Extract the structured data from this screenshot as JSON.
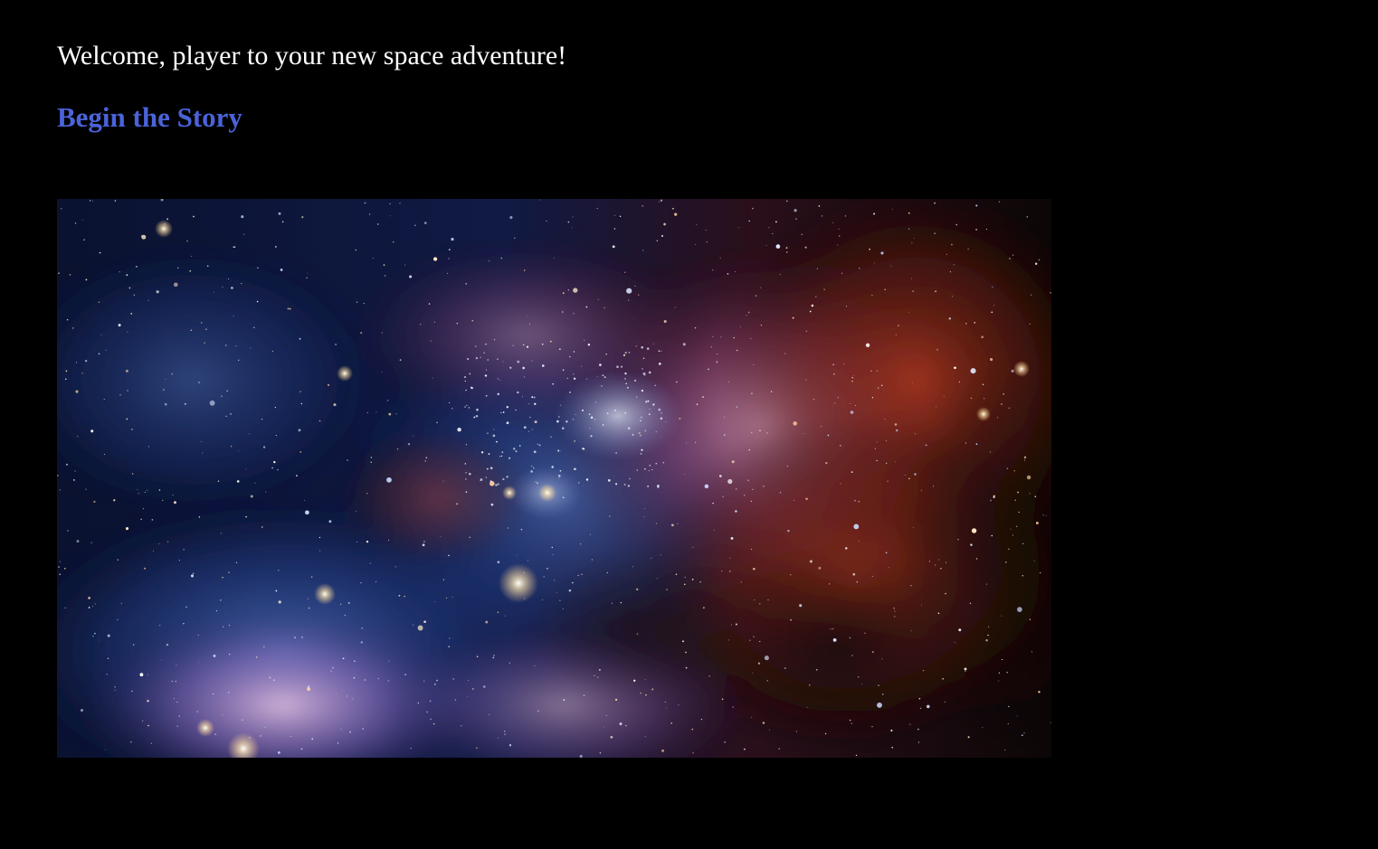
{
  "intro": {
    "welcome_text": "Welcome, player to your new space adventure!"
  },
  "actions": {
    "begin_story_label": "Begin the Story"
  },
  "theme": {
    "background": "#000000",
    "text_color": "#ffffff",
    "link_color": "#4a63d8"
  },
  "hero_image": {
    "alt": "Colorful nebula starfield"
  }
}
